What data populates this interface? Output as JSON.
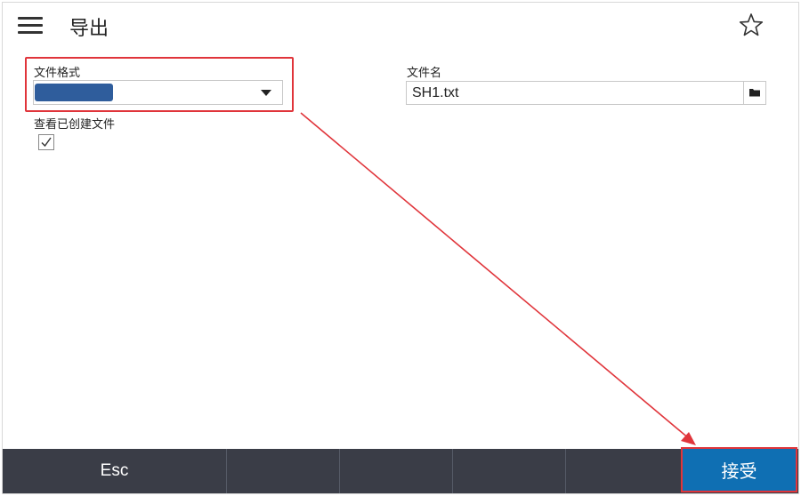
{
  "header": {
    "title": "导出",
    "menu_icon": "hamburger-menu-icon",
    "favorite_icon": "star-outline-icon"
  },
  "form": {
    "file_format": {
      "label": "文件格式",
      "selected_value": ""
    },
    "view_created_file": {
      "label": "查看已创建文件",
      "checked": true,
      "check_glyph": "✓"
    },
    "file_name": {
      "label": "文件名",
      "value": "SH1.txt",
      "browse_icon": "folder-icon"
    }
  },
  "bottom_bar": {
    "esc_label": "Esc",
    "accept_label": "接受"
  },
  "colors": {
    "accent": "#0f6fb3",
    "highlight": "#e0353b",
    "bar": "#3a3d47",
    "selection": "#2f5d9c"
  }
}
